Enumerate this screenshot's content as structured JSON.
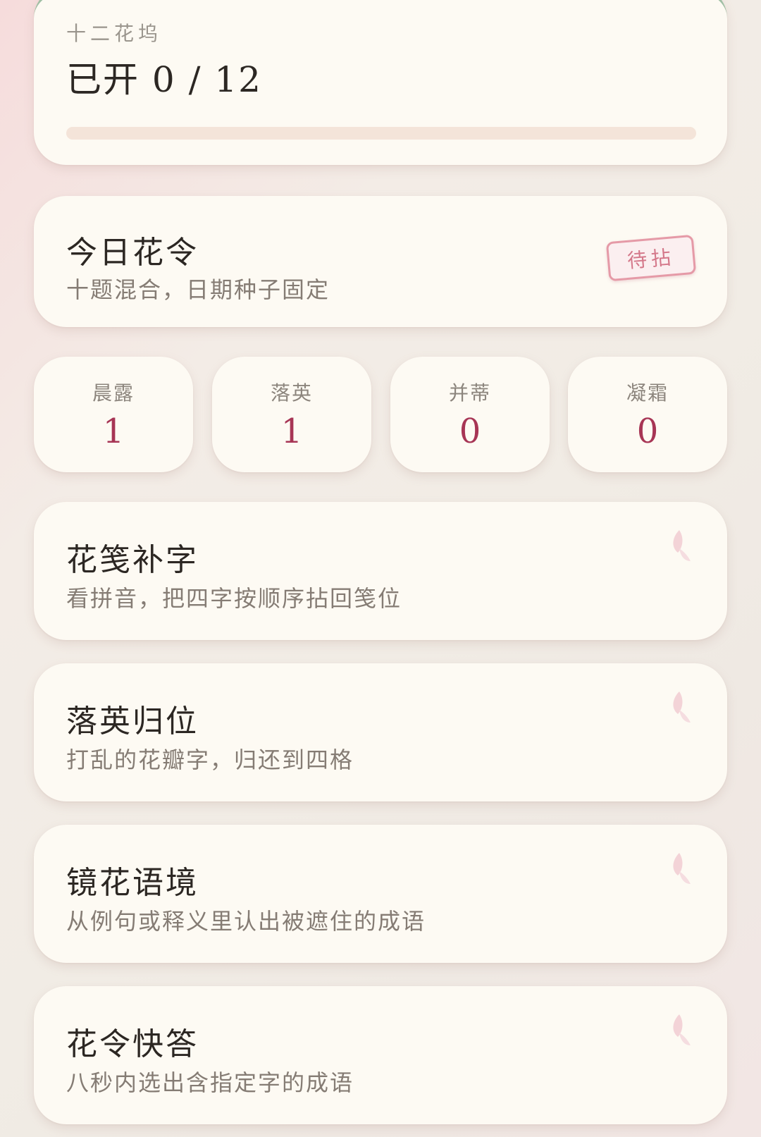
{
  "progress": {
    "label": "十二花坞",
    "value_text": "已开 0 / 12",
    "opened": 0,
    "total": 12
  },
  "daily": {
    "title": "今日花令",
    "subtitle": "十题混合，日期种子固定",
    "stamp": "待拈"
  },
  "stats": [
    {
      "label": "晨露",
      "value": "1"
    },
    {
      "label": "落英",
      "value": "1"
    },
    {
      "label": "并蒂",
      "value": "0"
    },
    {
      "label": "凝霜",
      "value": "0"
    }
  ],
  "games": [
    {
      "title": "花笺补字",
      "desc": "看拼音，把四字按顺序拈回笺位",
      "icon": "petal-icon"
    },
    {
      "title": "落英归位",
      "desc": "打乱的花瓣字，归还到四格",
      "icon": "petal-icon"
    },
    {
      "title": "镜花语境",
      "desc": "从例句或释义里认出被遮住的成语",
      "icon": "petal-icon"
    },
    {
      "title": "花令快答",
      "desc": "八秒内选出含指定字的成语",
      "icon": "petal-icon"
    }
  ],
  "colors": {
    "accent": "#a73555",
    "stamp": "#d4788a",
    "top_bar": "#9fbfa4",
    "card": "#fdfaf3"
  }
}
